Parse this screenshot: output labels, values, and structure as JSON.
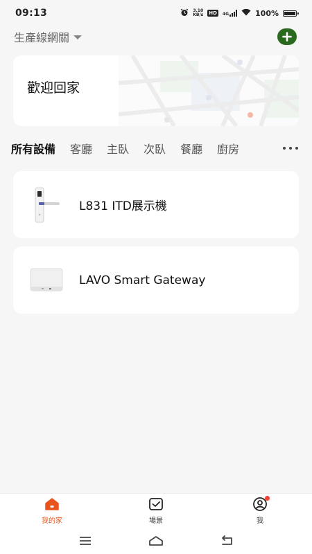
{
  "status_bar": {
    "time": "09:13",
    "net_speed_value": "3.10",
    "net_speed_unit": "KB/s",
    "hd_badge": "HD",
    "network_type": "4G",
    "battery": "100%"
  },
  "header": {
    "home_name": "生產線網關",
    "add_icon": "plus-icon"
  },
  "welcome": {
    "text": "歡迎回家"
  },
  "tabs": [
    {
      "label": "所有設備",
      "active": true
    },
    {
      "label": "客廳"
    },
    {
      "label": "主臥"
    },
    {
      "label": "次臥"
    },
    {
      "label": "餐廳"
    },
    {
      "label": "廚房"
    }
  ],
  "devices": [
    {
      "name": "L831 ITD展示機",
      "icon": "door-lock-icon"
    },
    {
      "name": "LAVO Smart Gateway",
      "icon": "gateway-icon"
    }
  ],
  "bottom_nav": [
    {
      "label": "我的家",
      "icon": "home-icon",
      "active": true
    },
    {
      "label": "場景",
      "icon": "scene-icon"
    },
    {
      "label": "我",
      "icon": "profile-icon"
    }
  ],
  "colors": {
    "accent": "#e8541e",
    "add_button": "#2a6a1f",
    "background": "#f6f6f6",
    "notification_dot": "#f44336"
  }
}
